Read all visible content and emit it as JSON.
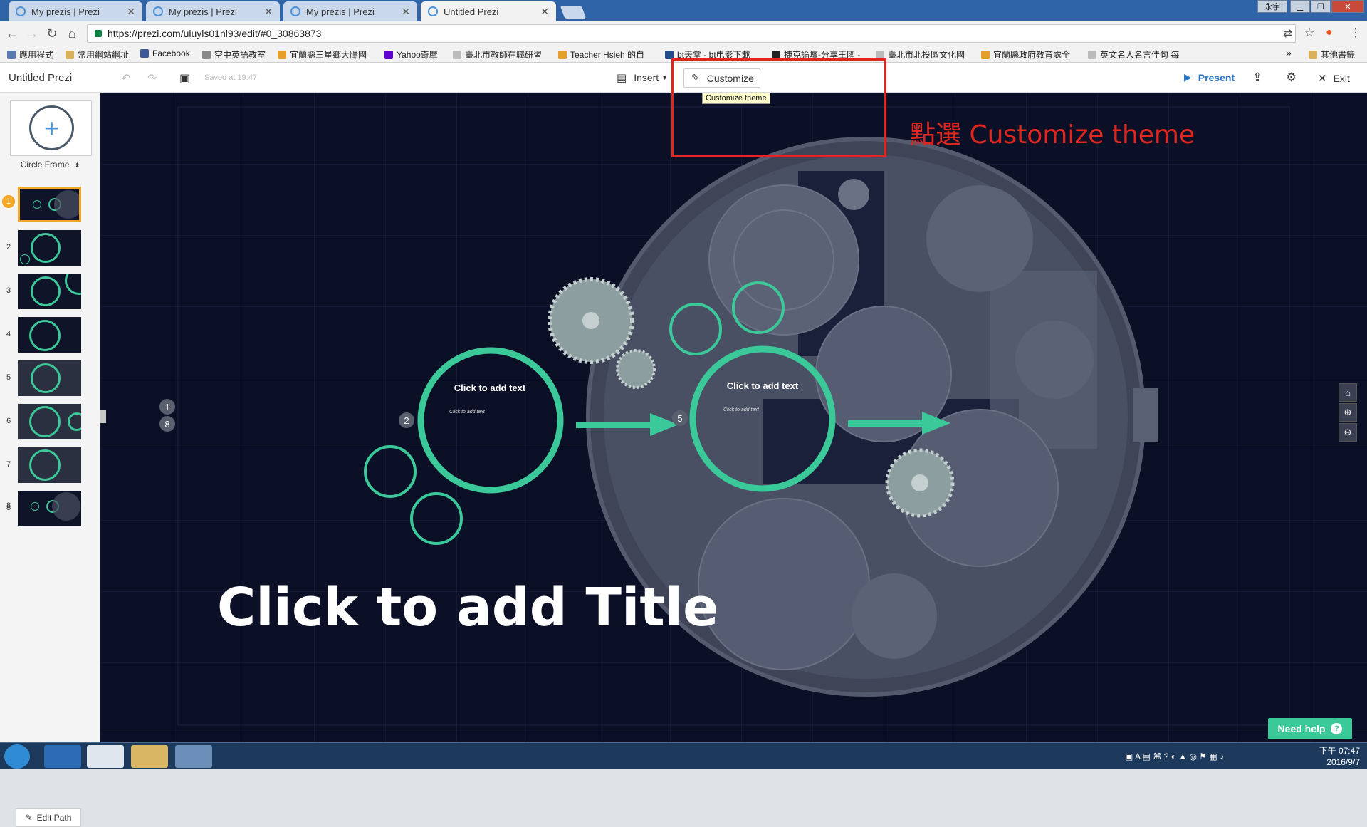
{
  "browser": {
    "tabs": [
      {
        "title": "My prezis | Prezi"
      },
      {
        "title": "My prezis | Prezi"
      },
      {
        "title": "My prezis | Prezi"
      },
      {
        "title": "Untitled Prezi"
      }
    ],
    "window_badge": "永宇",
    "url": "https://prezi.com/uluyls01nl93/edit/#0_30863873",
    "bookmarks": [
      "應用程式",
      "常用網站網址",
      "Facebook",
      "空中英語教室",
      "宜蘭縣三星鄉大隱國",
      "Yahoo奇摩",
      "臺北市教師在職研習",
      "Teacher Hsieh 的自",
      "bt天堂 - bt电影下載",
      "捷克論壇-分享王國 -",
      "臺北市北投區文化國",
      "宜蘭縣政府教育處全",
      "英文名人名言佳句 每"
    ],
    "bookmarks_overflow": "»",
    "other_bookmarks": "其他書籤"
  },
  "toolbar": {
    "title": "Untitled Prezi",
    "saved": "Saved at 19:47",
    "insert_label": "Insert",
    "customize_label": "Customize",
    "tooltip": "Customize theme",
    "present_label": "Present",
    "exit_label": "Exit"
  },
  "sidebar": {
    "frame_type": "Circle Frame",
    "thumbnails": [
      "1",
      "2",
      "3",
      "4",
      "5",
      "6",
      "7",
      "8"
    ],
    "active_badge": "1",
    "edit_path_label": "Edit Path"
  },
  "canvas": {
    "title_placeholder": "Click to add Title",
    "frame_text": "Click to add text",
    "frame_subtext": "Click to add text",
    "step_badges": [
      "1",
      "8",
      "2",
      "5"
    ],
    "need_help": "Need help"
  },
  "annotation": {
    "note": "點選 Customize theme"
  },
  "taskbar": {
    "time": "下午 07:47",
    "date": "2016/9/7"
  },
  "colors": {
    "accent_green": "#3cc99a",
    "canvas_bg": "#0c1027",
    "annotation_red": "#e0271f",
    "present_blue": "#2c77c9"
  }
}
